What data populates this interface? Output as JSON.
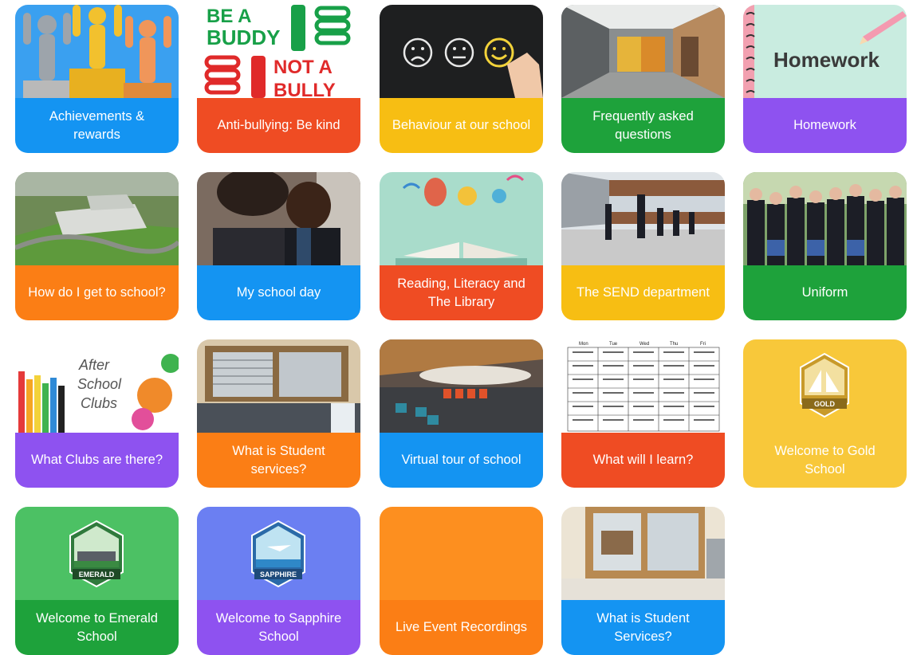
{
  "tiles": [
    {
      "label": "Achievements & rewards",
      "icon": "trophy-podium-icon",
      "color": "#1494f2"
    },
    {
      "label": "Anti-bullying: Be kind",
      "icon": "be-a-buddy-poster-icon",
      "color": "#ef4c23",
      "poster": {
        "line1": "BE A",
        "line2": "BUDDY",
        "line3": "NOT A",
        "line4": "BULLY"
      }
    },
    {
      "label": "Behaviour at our school",
      "icon": "chalkboard-faces-icon",
      "color": "#f7be13"
    },
    {
      "label": "Frequently asked questions",
      "icon": "school-corridor-photo",
      "color": "#1ea23b"
    },
    {
      "label": "Homework",
      "icon": "homework-notebook-icon",
      "color": "#8e52f0",
      "notebook_text": "Homework"
    },
    {
      "label": "How do I get to school?",
      "icon": "school-aerial-photo",
      "color": "#fb7e15"
    },
    {
      "label": "My school day",
      "icon": "students-working-photo",
      "color": "#1494f2"
    },
    {
      "label": "Reading, Literacy and The Library",
      "icon": "open-book-icon",
      "color": "#ef4c23"
    },
    {
      "label": "The SEND department",
      "icon": "students-running-photo",
      "color": "#f7be13"
    },
    {
      "label": "Uniform",
      "icon": "students-uniform-photo",
      "color": "#1ea23b"
    },
    {
      "label": "What Clubs are there?",
      "icon": "clubs-pencils-icon",
      "color": "#8e52f0",
      "clubs_text": {
        "l1": "After",
        "l2": "School",
        "l3": "Clubs"
      }
    },
    {
      "label": "What is Student services?",
      "icon": "service-window-photo",
      "color": "#fb7e15"
    },
    {
      "label": "Virtual tour of school",
      "icon": "school-atrium-photo",
      "color": "#1494f2"
    },
    {
      "label": "What will I learn?",
      "icon": "timetable-icon",
      "color": "#ef4c23",
      "timetable_days": [
        "Mon",
        "Tue",
        "Wed",
        "Thu",
        "Fri"
      ]
    },
    {
      "label": "Welcome to Gold School",
      "icon": "gold-badge-icon",
      "color": "#f8c83a",
      "badge": "GOLD"
    },
    {
      "label": "Welcome to Emerald School",
      "icon": "emerald-badge-icon",
      "color": "#1ea23b",
      "badge": "EMERALD"
    },
    {
      "label": "Welcome to Sapphire School",
      "icon": "sapphire-badge-icon",
      "color": "#8e52f0",
      "badge": "SAPPHIRE"
    },
    {
      "label": "Live Event Recordings",
      "icon": "blank-orange-panel",
      "color": "#fd8f1f"
    },
    {
      "label": "What is Student Services?",
      "icon": "service-window-photo",
      "color": "#1494f2"
    }
  ]
}
